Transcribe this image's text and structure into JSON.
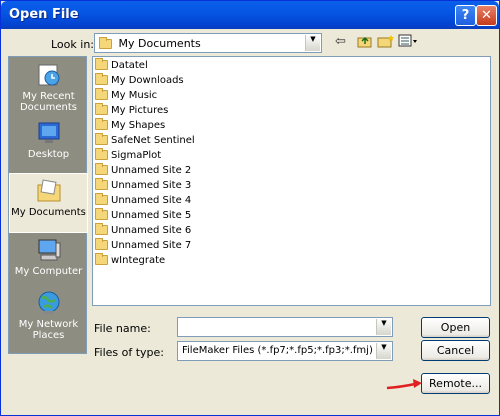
{
  "window": {
    "title": "Open File"
  },
  "titlebar": {
    "help_glyph": "?",
    "close_glyph": "✕"
  },
  "look_in": {
    "label": "Look in:",
    "value": "My Documents"
  },
  "places": [
    {
      "label": "My Recent Documents",
      "icon": "recent-documents-icon"
    },
    {
      "label": "Desktop",
      "icon": "desktop-icon"
    },
    {
      "label": "My Documents",
      "icon": "my-documents-icon",
      "selected": true
    },
    {
      "label": "My Computer",
      "icon": "my-computer-icon"
    },
    {
      "label": "My Network Places",
      "icon": "network-places-icon"
    }
  ],
  "files": [
    "Datatel",
    "My Downloads",
    "My Music",
    "My Pictures",
    "My Shapes",
    "SafeNet Sentinel",
    "SigmaPlot",
    "Unnamed Site 2",
    "Unnamed Site 3",
    "Unnamed Site 4",
    "Unnamed Site 5",
    "Unnamed Site 6",
    "Unnamed Site 7",
    "wIntegrate"
  ],
  "file_name": {
    "label": "File name:",
    "value": ""
  },
  "files_of_type": {
    "label": "Files of type:",
    "value": "FileMaker Files (*.fp7;*.fp5;*.fp3;*.fmj)"
  },
  "buttons": {
    "open": "Open",
    "cancel": "Cancel",
    "remote": "Remote..."
  },
  "colors": {
    "titlebar": "#0a5fe9",
    "places_bg": "#8e8d82",
    "annotation_arrow": "#e02020"
  }
}
